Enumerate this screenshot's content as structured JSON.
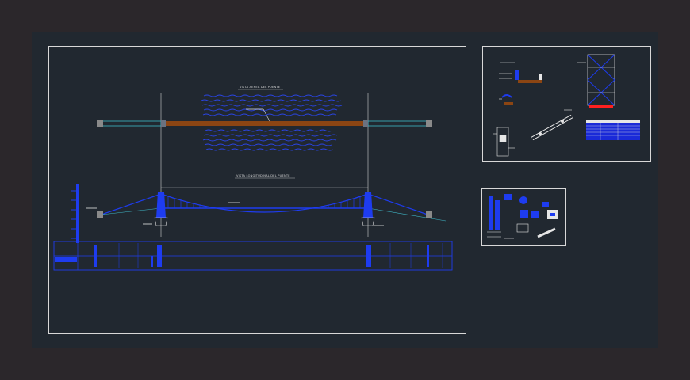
{
  "drawing": {
    "main_sheet": {
      "plan_view_title": "VISTA AEREA DEL PUENTE",
      "elevation_title": "VISTA LONGITUDINAL DEL PUENTE"
    },
    "detail_sheet_1": {},
    "detail_sheet_2": {}
  },
  "colors": {
    "background": "#2b272b",
    "model_space": "#212830",
    "border": "#d8d8d8",
    "blue": "#1e3cf0",
    "deck_brown": "#8b4513",
    "cyan": "#3fb8c8",
    "white": "#e6e6e6"
  },
  "icons": {
    "approach_block": "gray-square",
    "tower": "blue-pylon"
  }
}
